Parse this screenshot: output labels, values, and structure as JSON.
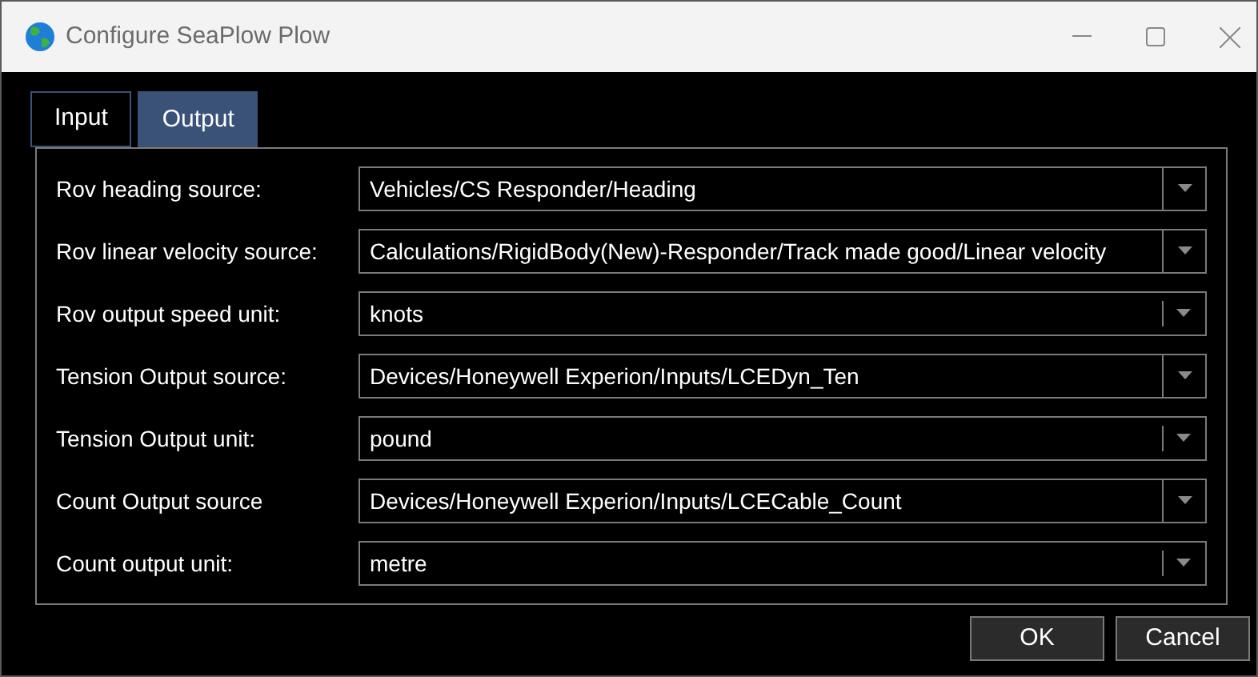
{
  "window": {
    "title": "Configure SeaPlow Plow"
  },
  "tabs": [
    {
      "label": "Input",
      "selected": false
    },
    {
      "label": "Output",
      "selected": true
    }
  ],
  "fields": [
    {
      "label": "Rov heading source:",
      "value": "Vehicles/CS Responder/Heading",
      "kind": "editable"
    },
    {
      "label": "Rov linear velocity source:",
      "value": "Calculations/RigidBody(New)-Responder/Track made good/Linear velocity",
      "kind": "editable"
    },
    {
      "label": "Rov output speed unit:",
      "value": "knots",
      "kind": "list"
    },
    {
      "label": "Tension Output source:",
      "value": "Devices/Honeywell Experion/Inputs/LCEDyn_Ten",
      "kind": "editable"
    },
    {
      "label": "Tension Output unit:",
      "value": "pound",
      "kind": "list"
    },
    {
      "label": "Count Output source",
      "value": "Devices/Honeywell Experion/Inputs/LCECable_Count",
      "kind": "editable"
    },
    {
      "label": "Count output unit:",
      "value": "metre",
      "kind": "list"
    }
  ],
  "buttons": [
    "OK",
    "Cancel"
  ]
}
